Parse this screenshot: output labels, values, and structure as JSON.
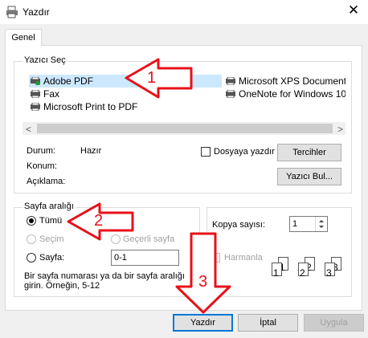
{
  "window": {
    "title": "Yazdır",
    "close_glyph": "✕"
  },
  "tabs": [
    {
      "label": "Genel"
    }
  ],
  "printer_group": {
    "label": "Yazıcı Seç",
    "printers": [
      {
        "name": "Adobe PDF",
        "selected": true,
        "icon": "printer-default-icon"
      },
      {
        "name": "Fax",
        "selected": false,
        "icon": "printer-icon"
      },
      {
        "name": "Microsoft Print to PDF",
        "selected": false,
        "icon": "printer-icon"
      },
      {
        "name": "Microsoft XPS Document",
        "selected": false,
        "icon": "printer-icon"
      },
      {
        "name": "OneNote for Windows 10",
        "selected": false,
        "icon": "printer-icon"
      }
    ],
    "status_label": "Durum:",
    "status_value": "Hazır",
    "location_label": "Konum:",
    "comment_label": "Açıklama:",
    "print_to_file_label": "Dosyaya yazdır",
    "preferences_button": "Tercihler",
    "find_printer_button": "Yazıcı Bul..."
  },
  "page_range": {
    "label": "Sayfa aralığı",
    "all_label": "Tümü",
    "selection_label": "Seçim",
    "current_page_label": "Geçerli sayfa",
    "pages_label": "Sayfa:",
    "pages_value": "0-1",
    "hint": "Bir sayfa numarası ya da bir sayfa aralığı girin.  Örneğin, 5-12"
  },
  "copies": {
    "label": "Kopya sayısı:",
    "value": "1",
    "collate_label": "Harmanla",
    "collate_pages": [
      "1",
      "1",
      "2",
      "2",
      "3",
      "3"
    ]
  },
  "buttons": {
    "print": "Yazdır",
    "cancel": "İptal",
    "apply": "Uygula"
  },
  "annotations": {
    "one": "1",
    "two": "2",
    "three": "3",
    "color": "#e8101a"
  }
}
